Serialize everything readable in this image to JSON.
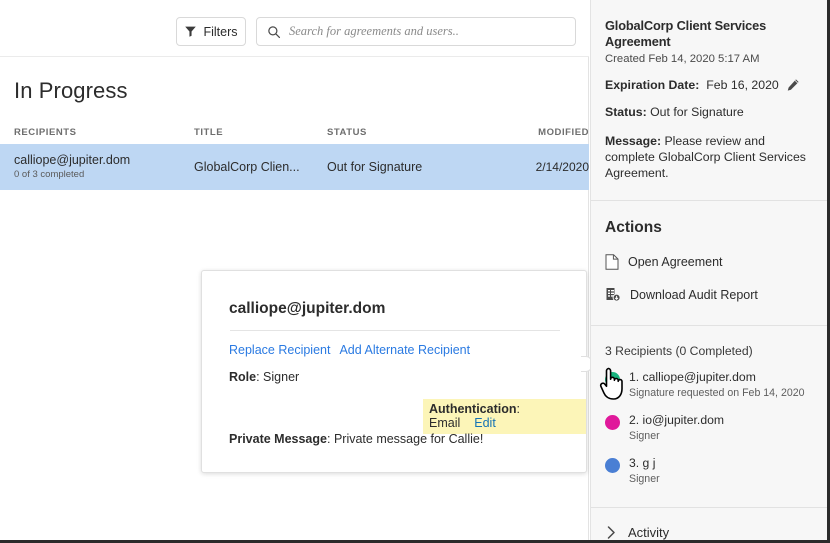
{
  "toolbar": {
    "filters_label": "Filters",
    "filter_icon": "funnel-icon",
    "search_icon": "search-icon",
    "search_placeholder": "Search for agreements and users.."
  },
  "main": {
    "section_title": "In Progress",
    "table": {
      "columns": [
        "RECIPIENTS",
        "TITLE",
        "STATUS",
        "MODIFIED"
      ],
      "rows": [
        {
          "recipient_email": "calliope@jupiter.dom",
          "recipient_sub": "0 of 3 completed",
          "title": "GlobalCorp Clien...",
          "status": "Out for Signature",
          "modified": "2/14/2020",
          "selected": true
        }
      ]
    }
  },
  "recipient_card": {
    "title": "calliope@jupiter.dom",
    "link_replace": "Replace Recipient",
    "link_add_alternate": "Add Alternate Recipient",
    "role_label": "Role",
    "role_value": "Signer",
    "auth_label": "Authentication",
    "auth_value": "Email",
    "auth_edit_link": "Edit",
    "auth_highlight_color": "#fcf5b8",
    "private_label": "Private Message",
    "private_value": "Private message for Callie!"
  },
  "right_panel": {
    "doc_title": "GlobalCorp Client Services Agreement",
    "created": "Created Feb 14, 2020 5:17 AM",
    "expiration_label": "Expiration Date:",
    "expiration_value": "Feb 16, 2020",
    "expiration_edit_icon": "pencil-icon",
    "status_label": "Status:",
    "status_value": "Out for Signature",
    "message_label": "Message:",
    "message_value": "Please review and complete GlobalCorp Client Services Agreement.",
    "actions_heading": "Actions",
    "actions": [
      {
        "label": "Open Agreement",
        "icon": "document-icon"
      },
      {
        "label": "Download Audit Report",
        "icon": "audit-report-icon"
      }
    ],
    "recipients_count_label": "3 Recipients (0 Completed)",
    "recipients": [
      {
        "name": "1. calliope@jupiter.dom",
        "sub": "Signature requested on Feb 14, 2020",
        "color": "#16b37e"
      },
      {
        "name": "2. io@jupiter.dom",
        "sub": "Signer",
        "color": "#e0199b"
      },
      {
        "name": "3. g j",
        "sub": "Signer",
        "color": "#4a7fd4"
      }
    ],
    "activity_label": "Activity",
    "activity_icon": "chevron-right-icon"
  },
  "cursor": {
    "icon": "pointing-hand-cursor"
  },
  "colors": {
    "row_selected": "#bed7f3",
    "link_blue": "#2a7ae2",
    "panel_bg": "#f7f7f7"
  }
}
